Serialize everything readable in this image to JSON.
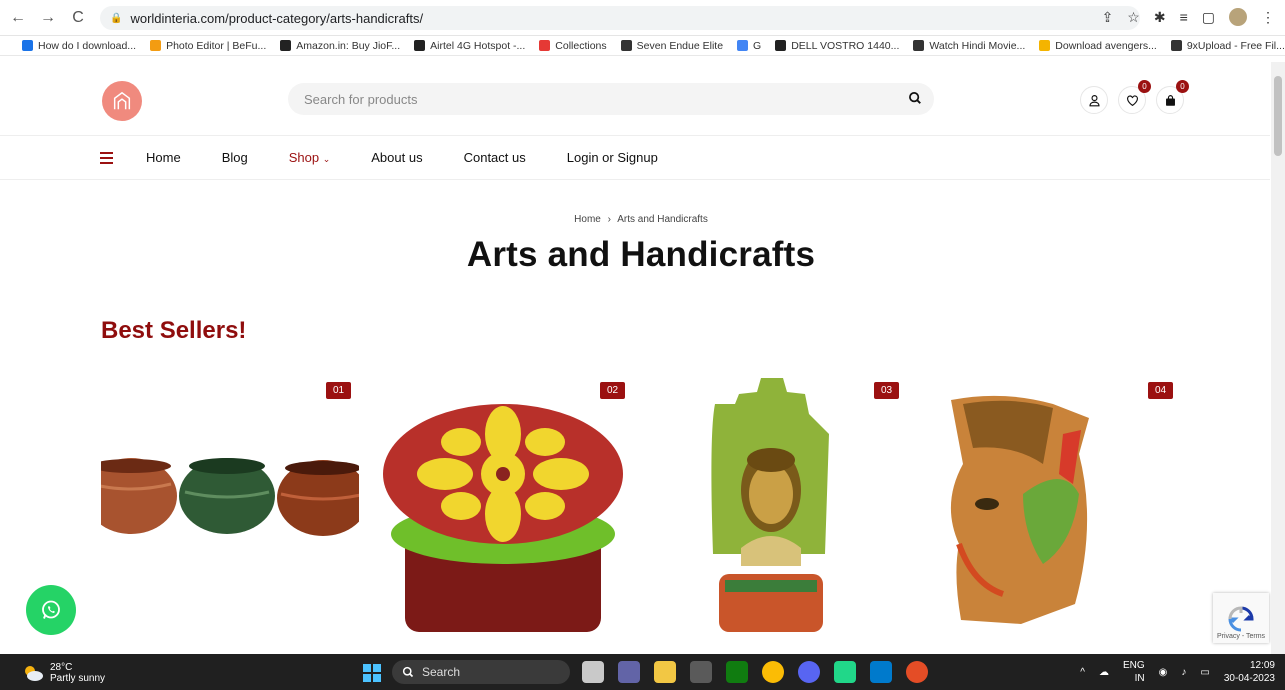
{
  "browser": {
    "url": "worldinteria.com/product-category/arts-handicrafts/",
    "bookmarks": [
      {
        "label": "How do I download...",
        "color": "#1a73e8"
      },
      {
        "label": "Photo Editor | BeFu...",
        "color": "#f39c12"
      },
      {
        "label": "Amazon.in: Buy JioF...",
        "color": "#222222"
      },
      {
        "label": "Airtel 4G Hotspot -...",
        "color": "#222222"
      },
      {
        "label": "Collections",
        "color": "#e53935"
      },
      {
        "label": "Seven Endue Elite",
        "color": "#333333"
      },
      {
        "label": "G",
        "color": "#4285f4"
      },
      {
        "label": "DELL VOSTRO 1440...",
        "color": "#222222"
      },
      {
        "label": "Watch Hindi Movie...",
        "color": "#333333"
      },
      {
        "label": "Download avengers...",
        "color": "#f4b400"
      },
      {
        "label": "9xUpload - Free Fil...",
        "color": "#333333"
      }
    ],
    "more": "»"
  },
  "header": {
    "search_placeholder": "Search for products",
    "wishlist_count": "0",
    "cart_count": "0"
  },
  "nav": {
    "items": [
      "Home",
      "Blog",
      "Shop",
      "About us",
      "Contact us",
      "Login or Signup"
    ]
  },
  "breadcrumb": {
    "home": "Home",
    "separator": "›",
    "current": "Arts and Handicrafts"
  },
  "page_title": "Arts and Handicrafts",
  "section_title": "Best Sellers!",
  "products": [
    {
      "rank": "01"
    },
    {
      "rank": "02"
    },
    {
      "rank": "03"
    },
    {
      "rank": "04"
    }
  ],
  "recaptcha": {
    "label": "Privacy - Terms"
  },
  "taskbar": {
    "temperature": "28°C",
    "weather": "Partly sunny",
    "search": "Search",
    "lang": "ENG",
    "region": "IN",
    "time": "12:09",
    "date": "30-04-2023"
  },
  "colors": {
    "accent": "#9b1111",
    "logo": "#f08a7e",
    "whatsapp": "#25d366"
  }
}
